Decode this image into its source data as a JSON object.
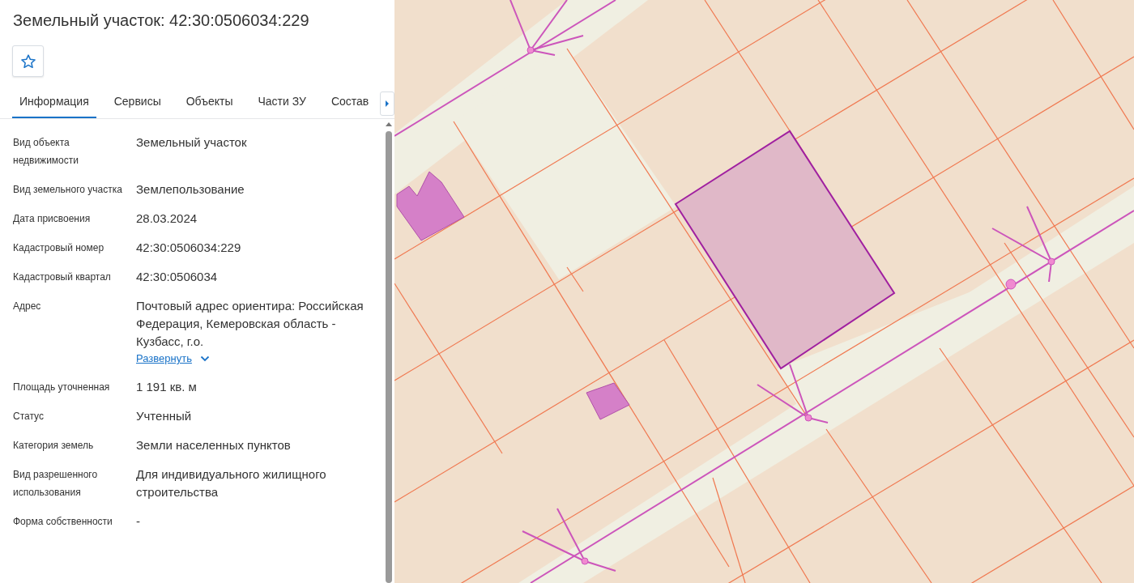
{
  "title": "Земельный участок: 42:30:0506034:229",
  "favorite": {
    "on": false
  },
  "tabs": [
    {
      "label": "Информация",
      "selected": true
    },
    {
      "label": "Сервисы",
      "selected": false
    },
    {
      "label": "Объекты",
      "selected": false
    },
    {
      "label": "Части ЗУ",
      "selected": false
    },
    {
      "label": "Состав",
      "selected": false
    }
  ],
  "fields": [
    {
      "kind": "text",
      "label": "Вид объекта недвижимости",
      "value": "Земельный участок"
    },
    {
      "kind": "text",
      "label": "Вид земельного участка",
      "value": "Землепользование"
    },
    {
      "kind": "text",
      "label": "Дата присвоения",
      "value": "28.03.2024"
    },
    {
      "kind": "text",
      "label": "Кадастровый номер",
      "value": "42:30:0506034:229"
    },
    {
      "kind": "text",
      "label": "Кадастровый квартал",
      "value": "42:30:0506034"
    },
    {
      "kind": "expandable",
      "label": "Адрес",
      "value": "Почтовый адрес ориентира: Российская Федерация, Кемеровская область - Кузбасс, г.о.",
      "link": "Развернуть"
    },
    {
      "kind": "text",
      "label": "Площадь уточненная",
      "value": "1 191 кв. м"
    },
    {
      "kind": "text",
      "label": "Статус",
      "value": "Учтенный"
    },
    {
      "kind": "text",
      "label": "Категория земель",
      "value": "Земли населенных пунктов"
    },
    {
      "kind": "text",
      "label": "Вид разрешенного использования",
      "value": "Для индивидуального жилищного строительства"
    },
    {
      "kind": "text",
      "label": "Форма собственности",
      "value": "-"
    }
  ]
}
